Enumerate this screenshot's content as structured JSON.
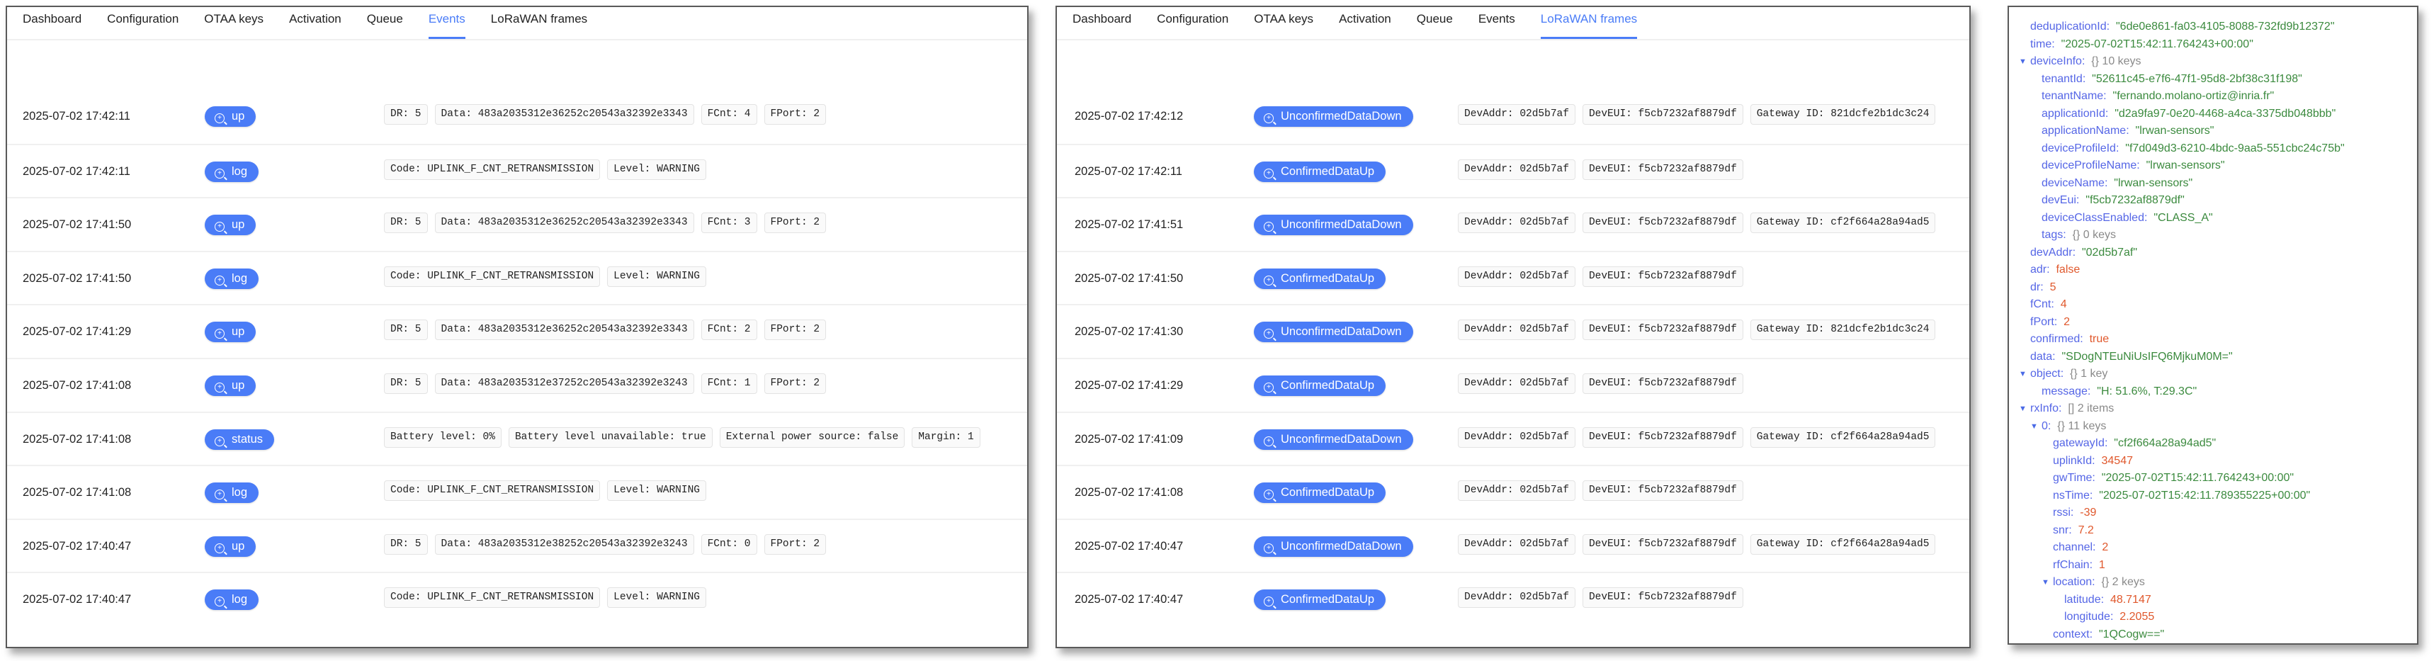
{
  "colors": {
    "accent": "#4a7cf7",
    "json_key": "#5566e6",
    "json_string": "#3b8a3e",
    "json_number": "#e0582c",
    "json_meta": "#8a8a8a"
  },
  "left": {
    "tabs": [
      "Dashboard",
      "Configuration",
      "OTAA keys",
      "Activation",
      "Queue",
      "Events",
      "LoRaWAN frames"
    ],
    "active_tab": "Events",
    "rows": [
      {
        "time": "2025-07-02 17:42:11",
        "type": "up",
        "chips": [
          "DR: 5",
          "Data: 483a2035312e36252c20543a32392e3343",
          "FCnt: 4",
          "FPort: 2"
        ]
      },
      {
        "time": "2025-07-02 17:42:11",
        "type": "log",
        "chips": [
          "Code: UPLINK_F_CNT_RETRANSMISSION",
          "Level: WARNING"
        ]
      },
      {
        "time": "2025-07-02 17:41:50",
        "type": "up",
        "chips": [
          "DR: 5",
          "Data: 483a2035312e36252c20543a32392e3343",
          "FCnt: 3",
          "FPort: 2"
        ]
      },
      {
        "time": "2025-07-02 17:41:50",
        "type": "log",
        "chips": [
          "Code: UPLINK_F_CNT_RETRANSMISSION",
          "Level: WARNING"
        ]
      },
      {
        "time": "2025-07-02 17:41:29",
        "type": "up",
        "chips": [
          "DR: 5",
          "Data: 483a2035312e36252c20543a32392e3343",
          "FCnt: 2",
          "FPort: 2"
        ]
      },
      {
        "time": "2025-07-02 17:41:08",
        "type": "up",
        "chips": [
          "DR: 5",
          "Data: 483a2035312e37252c20543a32392e3243",
          "FCnt: 1",
          "FPort: 2"
        ]
      },
      {
        "time": "2025-07-02 17:41:08",
        "type": "status",
        "chips": [
          "Battery level: 0%",
          "Battery level unavailable: true",
          "External power source: false",
          "Margin: 1"
        ]
      },
      {
        "time": "2025-07-02 17:41:08",
        "type": "log",
        "chips": [
          "Code: UPLINK_F_CNT_RETRANSMISSION",
          "Level: WARNING"
        ]
      },
      {
        "time": "2025-07-02 17:40:47",
        "type": "up",
        "chips": [
          "DR: 5",
          "Data: 483a2035312e38252c20543a32392e3243",
          "FCnt: 0",
          "FPort: 2"
        ]
      },
      {
        "time": "2025-07-02 17:40:47",
        "type": "log",
        "chips": [
          "Code: UPLINK_F_CNT_RETRANSMISSION",
          "Level: WARNING"
        ]
      }
    ]
  },
  "middle": {
    "tabs": [
      "Dashboard",
      "Configuration",
      "OTAA keys",
      "Activation",
      "Queue",
      "Events",
      "LoRaWAN frames"
    ],
    "active_tab": "LoRaWAN frames",
    "rows": [
      {
        "time": "2025-07-02 17:42:12",
        "type": "UnconfirmedDataDown",
        "chips": [
          "DevAddr: 02d5b7af",
          "DevEUI: f5cb7232af8879df",
          "Gateway ID: 821dcfe2b1dc3c24"
        ]
      },
      {
        "time": "2025-07-02 17:42:11",
        "type": "ConfirmedDataUp",
        "chips": [
          "DevAddr: 02d5b7af",
          "DevEUI: f5cb7232af8879df"
        ]
      },
      {
        "time": "2025-07-02 17:41:51",
        "type": "UnconfirmedDataDown",
        "chips": [
          "DevAddr: 02d5b7af",
          "DevEUI: f5cb7232af8879df",
          "Gateway ID: cf2f664a28a94ad5"
        ]
      },
      {
        "time": "2025-07-02 17:41:50",
        "type": "ConfirmedDataUp",
        "chips": [
          "DevAddr: 02d5b7af",
          "DevEUI: f5cb7232af8879df"
        ]
      },
      {
        "time": "2025-07-02 17:41:30",
        "type": "UnconfirmedDataDown",
        "chips": [
          "DevAddr: 02d5b7af",
          "DevEUI: f5cb7232af8879df",
          "Gateway ID: 821dcfe2b1dc3c24"
        ]
      },
      {
        "time": "2025-07-02 17:41:29",
        "type": "ConfirmedDataUp",
        "chips": [
          "DevAddr: 02d5b7af",
          "DevEUI: f5cb7232af8879df"
        ]
      },
      {
        "time": "2025-07-02 17:41:09",
        "type": "UnconfirmedDataDown",
        "chips": [
          "DevAddr: 02d5b7af",
          "DevEUI: f5cb7232af8879df",
          "Gateway ID: cf2f664a28a94ad5"
        ]
      },
      {
        "time": "2025-07-02 17:41:08",
        "type": "ConfirmedDataUp",
        "chips": [
          "DevAddr: 02d5b7af",
          "DevEUI: f5cb7232af8879df"
        ]
      },
      {
        "time": "2025-07-02 17:40:47",
        "type": "UnconfirmedDataDown",
        "chips": [
          "DevAddr: 02d5b7af",
          "DevEUI: f5cb7232af8879df",
          "Gateway ID: cf2f664a28a94ad5"
        ]
      },
      {
        "time": "2025-07-02 17:40:47",
        "type": "ConfirmedDataUp",
        "chips": [
          "DevAddr: 02d5b7af",
          "DevEUI: f5cb7232af8879df"
        ]
      }
    ]
  },
  "json_tree": [
    {
      "depth": 0,
      "key": "deduplicationId",
      "value": "\"6de0e861-fa03-4105-8088-732fd9b12372\"",
      "kind": "string"
    },
    {
      "depth": 0,
      "key": "time",
      "value": "\"2025-07-02T15:42:11.764243+00:00\"",
      "kind": "string"
    },
    {
      "depth": 0,
      "key": "deviceInfo",
      "value": "{}  10 keys",
      "kind": "meta",
      "expanded": true
    },
    {
      "depth": 1,
      "key": "tenantId",
      "value": "\"52611c45-e7f6-47f1-95d8-2bf38c31f198\"",
      "kind": "string"
    },
    {
      "depth": 1,
      "key": "tenantName",
      "value": "\"fernando.molano-ortiz@inria.fr\"",
      "kind": "string"
    },
    {
      "depth": 1,
      "key": "applicationId",
      "value": "\"d2a9fa97-0e20-4468-a4ca-3375db048bbb\"",
      "kind": "string"
    },
    {
      "depth": 1,
      "key": "applicationName",
      "value": "\"lrwan-sensors\"",
      "kind": "string"
    },
    {
      "depth": 1,
      "key": "deviceProfileId",
      "value": "\"f7d049d3-6210-4bdc-9aa5-551cbc24c75b\"",
      "kind": "string"
    },
    {
      "depth": 1,
      "key": "deviceProfileName",
      "value": "\"lrwan-sensors\"",
      "kind": "string"
    },
    {
      "depth": 1,
      "key": "deviceName",
      "value": "\"lrwan-sensors\"",
      "kind": "string"
    },
    {
      "depth": 1,
      "key": "devEui",
      "value": "\"f5cb7232af8879df\"",
      "kind": "string"
    },
    {
      "depth": 1,
      "key": "deviceClassEnabled",
      "value": "\"CLASS_A\"",
      "kind": "string"
    },
    {
      "depth": 1,
      "key": "tags",
      "value": "{}  0 keys",
      "kind": "meta"
    },
    {
      "depth": 0,
      "key": "devAddr",
      "value": "\"02d5b7af\"",
      "kind": "string"
    },
    {
      "depth": 0,
      "key": "adr",
      "value": "false",
      "kind": "number"
    },
    {
      "depth": 0,
      "key": "dr",
      "value": "5",
      "kind": "number"
    },
    {
      "depth": 0,
      "key": "fCnt",
      "value": "4",
      "kind": "number"
    },
    {
      "depth": 0,
      "key": "fPort",
      "value": "2",
      "kind": "number"
    },
    {
      "depth": 0,
      "key": "confirmed",
      "value": "true",
      "kind": "number"
    },
    {
      "depth": 0,
      "key": "data",
      "value": "\"SDogNTEuNiUsIFQ6MjkuM0M=\"",
      "kind": "string"
    },
    {
      "depth": 0,
      "key": "object",
      "value": "{}  1 key",
      "kind": "meta",
      "expanded": true
    },
    {
      "depth": 1,
      "key": "message",
      "value": "\"H: 51.6%, T:29.3C\"",
      "kind": "string"
    },
    {
      "depth": 0,
      "key": "rxInfo",
      "value": "[]  2 items",
      "kind": "meta",
      "expanded": true
    },
    {
      "depth": 1,
      "key": "0",
      "value": "{}  11 keys",
      "kind": "meta",
      "expanded": true
    },
    {
      "depth": 2,
      "key": "gatewayId",
      "value": "\"cf2f664a28a94ad5\"",
      "kind": "string"
    },
    {
      "depth": 2,
      "key": "uplinkId",
      "value": "34547",
      "kind": "number"
    },
    {
      "depth": 2,
      "key": "gwTime",
      "value": "\"2025-07-02T15:42:11.764243+00:00\"",
      "kind": "string"
    },
    {
      "depth": 2,
      "key": "nsTime",
      "value": "\"2025-07-02T15:42:11.789355225+00:00\"",
      "kind": "string"
    },
    {
      "depth": 2,
      "key": "rssi",
      "value": "-39",
      "kind": "number"
    },
    {
      "depth": 2,
      "key": "snr",
      "value": "7.2",
      "kind": "number"
    },
    {
      "depth": 2,
      "key": "channel",
      "value": "2",
      "kind": "number"
    },
    {
      "depth": 2,
      "key": "rfChain",
      "value": "1",
      "kind": "number"
    },
    {
      "depth": 2,
      "key": "location",
      "value": "{}  2 keys",
      "kind": "meta",
      "expanded": true
    },
    {
      "depth": 3,
      "key": "latitude",
      "value": "48.7147",
      "kind": "number"
    },
    {
      "depth": 3,
      "key": "longitude",
      "value": "2.2055",
      "kind": "number"
    },
    {
      "depth": 2,
      "key": "context",
      "value": "\"1QCogw==\"",
      "kind": "string"
    }
  ]
}
